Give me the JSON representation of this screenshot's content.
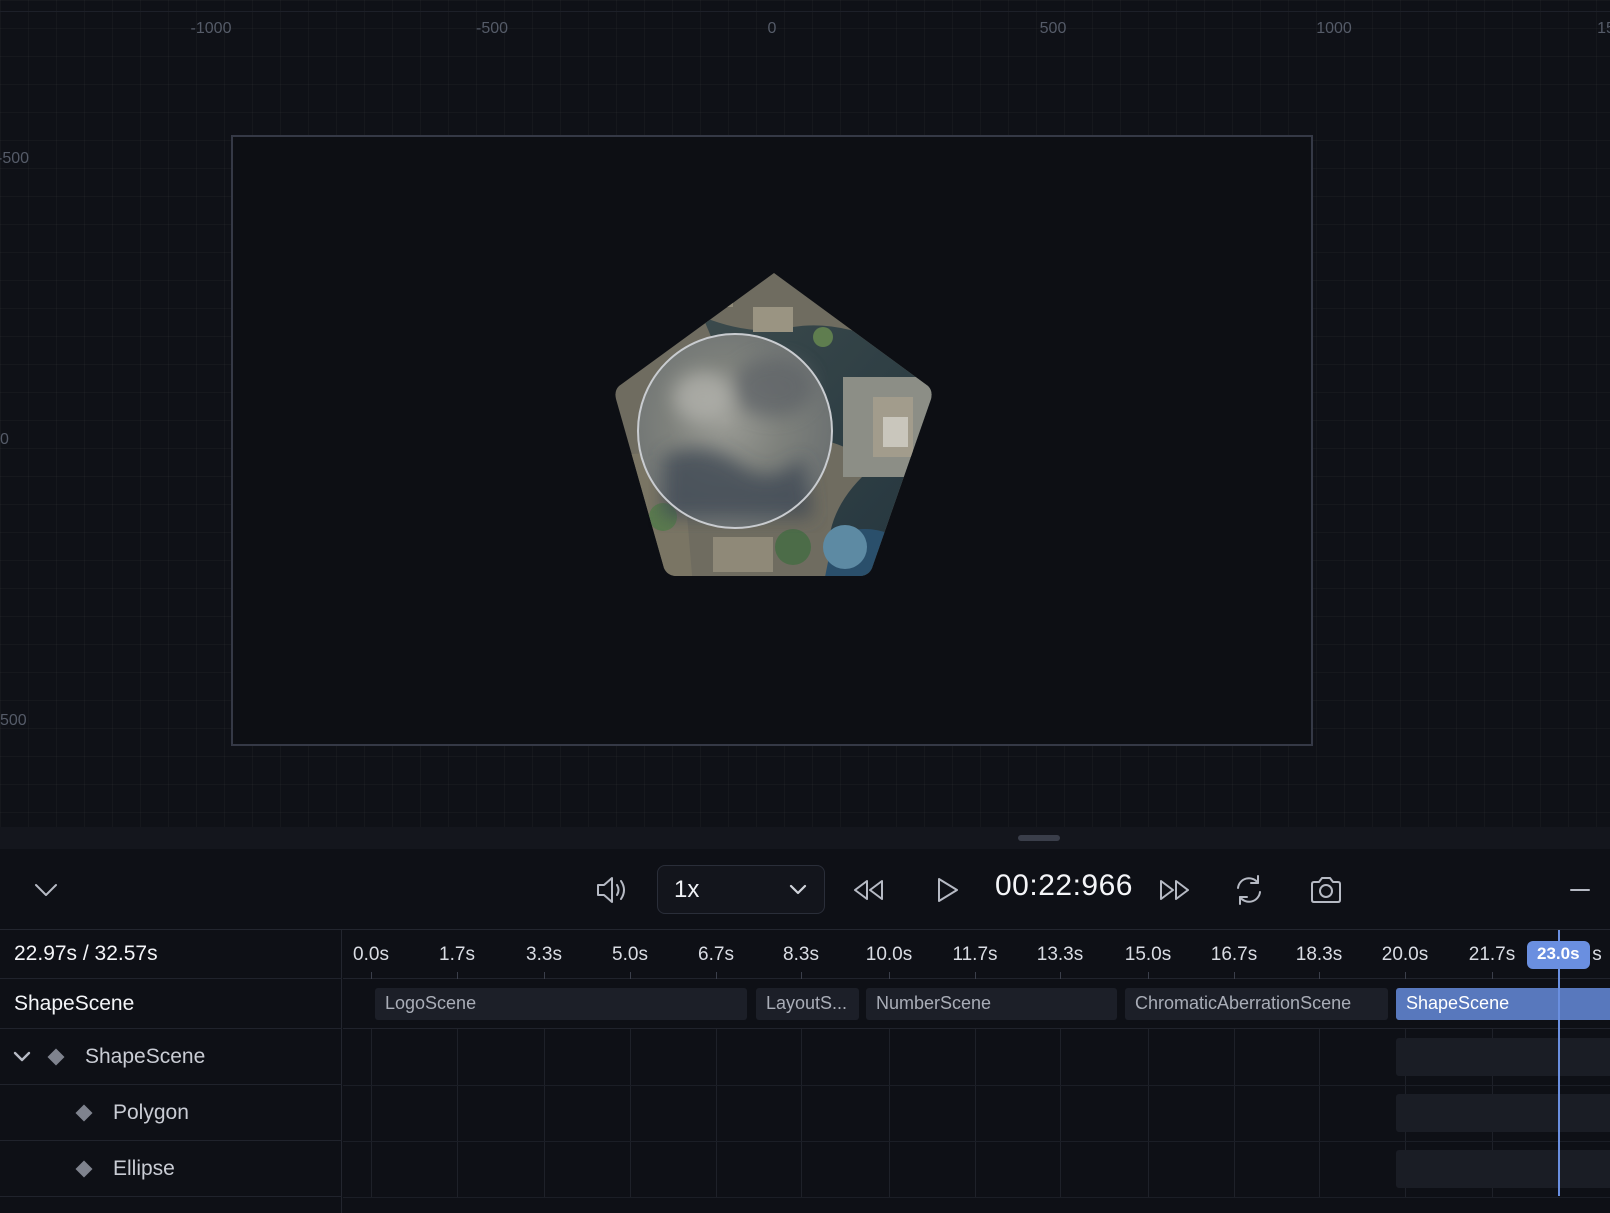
{
  "viewport": {
    "ruler_x": [
      "-1000",
      "-500",
      "0",
      "500",
      "1000",
      "15"
    ],
    "ruler_y": [
      "-500",
      "0",
      "500"
    ]
  },
  "toolbar": {
    "speed": "1x",
    "time": "00:22:966"
  },
  "timeline": {
    "time_summary": "22.97s / 32.57s",
    "scene_label": "ShapeScene",
    "ticks": [
      "0.0s",
      "1.7s",
      "3.3s",
      "5.0s",
      "6.7s",
      "8.3s",
      "10.0s",
      "11.7s",
      "13.3s",
      "15.0s",
      "16.7s",
      "18.3s",
      "20.0s",
      "21.7s",
      "s"
    ],
    "playhead": "23.0s",
    "scenes": [
      {
        "label": "LogoScene",
        "active": false
      },
      {
        "label": "LayoutS...",
        "active": false
      },
      {
        "label": "NumberScene",
        "active": false
      },
      {
        "label": "ChromaticAberrationScene",
        "active": false
      },
      {
        "label": "ShapeScene",
        "active": true
      }
    ],
    "nodes": [
      {
        "label": "ShapeScene"
      },
      {
        "label": "Polygon"
      },
      {
        "label": "Ellipse"
      }
    ]
  },
  "colors": {
    "accent": "#6a8fe0",
    "active_scene": "#5878bd",
    "background": "#0e1016"
  }
}
